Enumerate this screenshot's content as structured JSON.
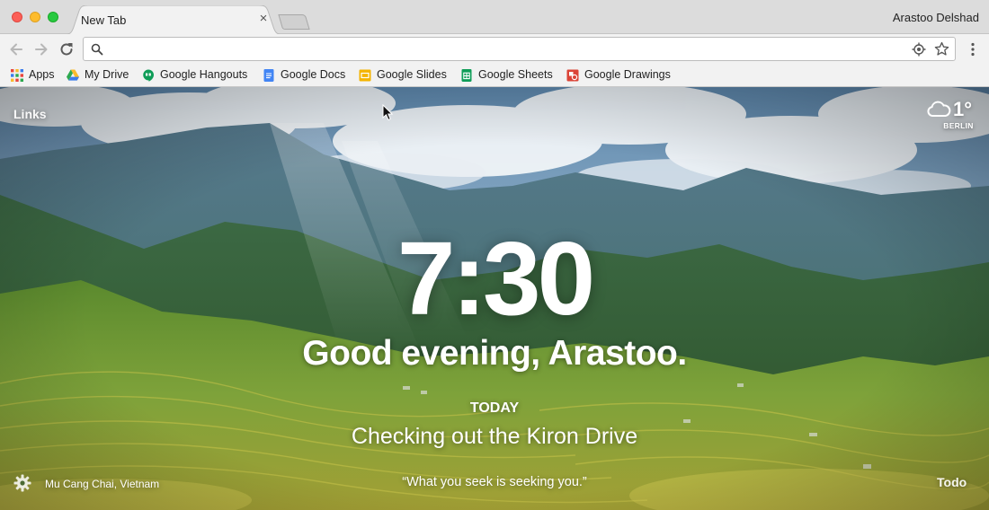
{
  "browser": {
    "tab": {
      "title": "New Tab",
      "close_glyph": "×"
    },
    "profile_name": "Arastoo Delshad",
    "omnibox": {
      "value": "",
      "placeholder": ""
    },
    "bookmarks": [
      {
        "label": "Apps",
        "icon": "apps-grid-icon"
      },
      {
        "label": "My Drive",
        "icon": "google-drive-icon"
      },
      {
        "label": "Google Hangouts",
        "icon": "hangouts-icon"
      },
      {
        "label": "Google Docs",
        "icon": "google-docs-icon"
      },
      {
        "label": "Google Slides",
        "icon": "google-slides-icon"
      },
      {
        "label": "Google Sheets",
        "icon": "google-sheets-icon"
      },
      {
        "label": "Google Drawings",
        "icon": "google-drawings-icon"
      }
    ]
  },
  "momentum": {
    "links_label": "Links",
    "weather": {
      "temperature": "1°",
      "city": "BERLIN",
      "icon": "cloud-icon"
    },
    "clock": "7:30",
    "greeting": "Good evening, Arastoo.",
    "focus": {
      "label": "TODAY",
      "text": "Checking out the Kiron Drive"
    },
    "background_location": "Mu Cang Chai, Vietnam",
    "quote": "“What you seek is seeking you.”",
    "todo_label": "Todo"
  },
  "colors": {
    "traffic_close": "#fc5f57",
    "traffic_minimize": "#fdbc2e",
    "traffic_maximize": "#28c940",
    "toolbar_bg": "#f2f2f2",
    "titlebar_bg": "#dcdcdc"
  }
}
